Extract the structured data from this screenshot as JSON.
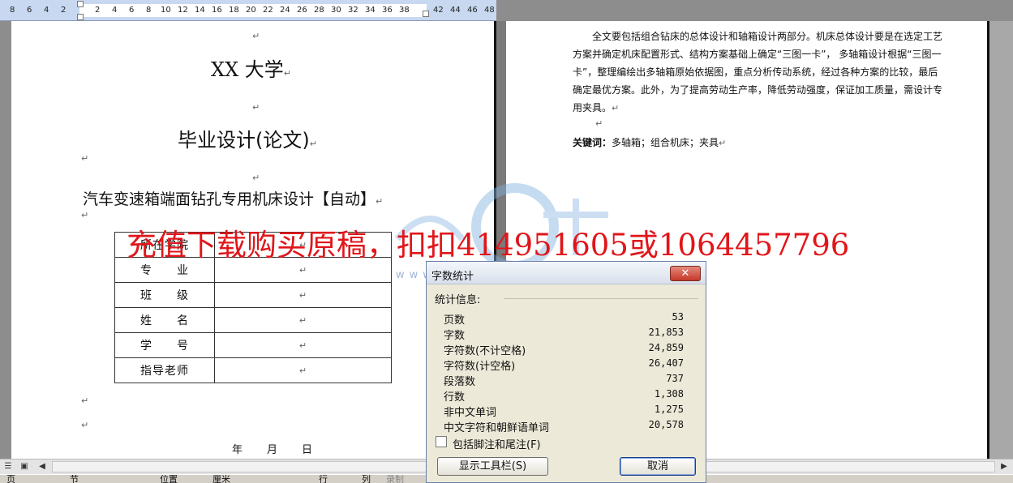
{
  "ruler": {
    "left_numbers": [
      "8",
      "6",
      "4",
      "2"
    ],
    "numbers": [
      "2",
      "4",
      "6",
      "8",
      "10",
      "12",
      "14",
      "16",
      "18",
      "20",
      "22",
      "24",
      "26",
      "28",
      "30",
      "32",
      "34",
      "36",
      "38"
    ],
    "right_numbers": [
      "42",
      "44",
      "46",
      "48"
    ]
  },
  "left_page": {
    "university": "XX 大学",
    "thesis": "毕业设计(论文)",
    "topic": "汽车变速箱端面钻孔专用机床设计【自动】",
    "table": [
      {
        "label": "所在学院",
        "value": "↵"
      },
      {
        "label": "专　　业",
        "value": "↵"
      },
      {
        "label": "班　　级",
        "value": "↵"
      },
      {
        "label": "姓　　名",
        "value": "↵"
      },
      {
        "label": "学　　号",
        "value": "↵"
      },
      {
        "label": "指导老师",
        "value": "↵"
      }
    ],
    "date": {
      "year": "年",
      "month": "月",
      "day": "日"
    },
    "para_mark": "↵"
  },
  "right_page": {
    "abstract": "全文要包括组合钻床的总体设计和轴箱设计两部分。机床总体设计要是在选定工艺方案并确定机床配置形式、结构方案基础上确定“三图一卡”， 多轴箱设计根据“三图一卡”，整理编绘出多轴箱原始依据图，重点分析传动系统，经过各种方案的比较，最后确定最优方案。此外，为了提高劳动生产率，降低劳动强度，保证加工质量，需设计专用夹具。",
    "keywords_label": "关键词：",
    "keywords": "多轴箱；组合机床；夹具"
  },
  "watermark": {
    "promo": "充值下载购买原稿，扣扣414951605或1064457796",
    "url": "www.renrendoc.com"
  },
  "dialog": {
    "title": "字数统计",
    "close": "✕",
    "section": "统计信息:",
    "stats": [
      {
        "label": "页数",
        "value": "53"
      },
      {
        "label": "字数",
        "value": "21,853"
      },
      {
        "label": "字符数(不计空格)",
        "value": "24,859"
      },
      {
        "label": "字符数(计空格)",
        "value": "26,407"
      },
      {
        "label": "段落数",
        "value": "737"
      },
      {
        "label": "行数",
        "value": "1,308"
      },
      {
        "label": "非中文单词",
        "value": "1,275"
      },
      {
        "label": "中文字符和朝鲜语单词",
        "value": "20,578"
      }
    ],
    "checkbox_label": "包括脚注和尾注(F)",
    "show_toolbar": "显示工具栏(S)",
    "cancel": "取消"
  },
  "statusbar": {
    "page": "页",
    "section": "节",
    "position": "位置",
    "unit": "厘米",
    "line": "行",
    "col": "列",
    "record": "录制"
  },
  "colors": {
    "promo": "#e0161a",
    "ruler": "#c7d8f0",
    "dialog_bg": "#ece9d8"
  }
}
